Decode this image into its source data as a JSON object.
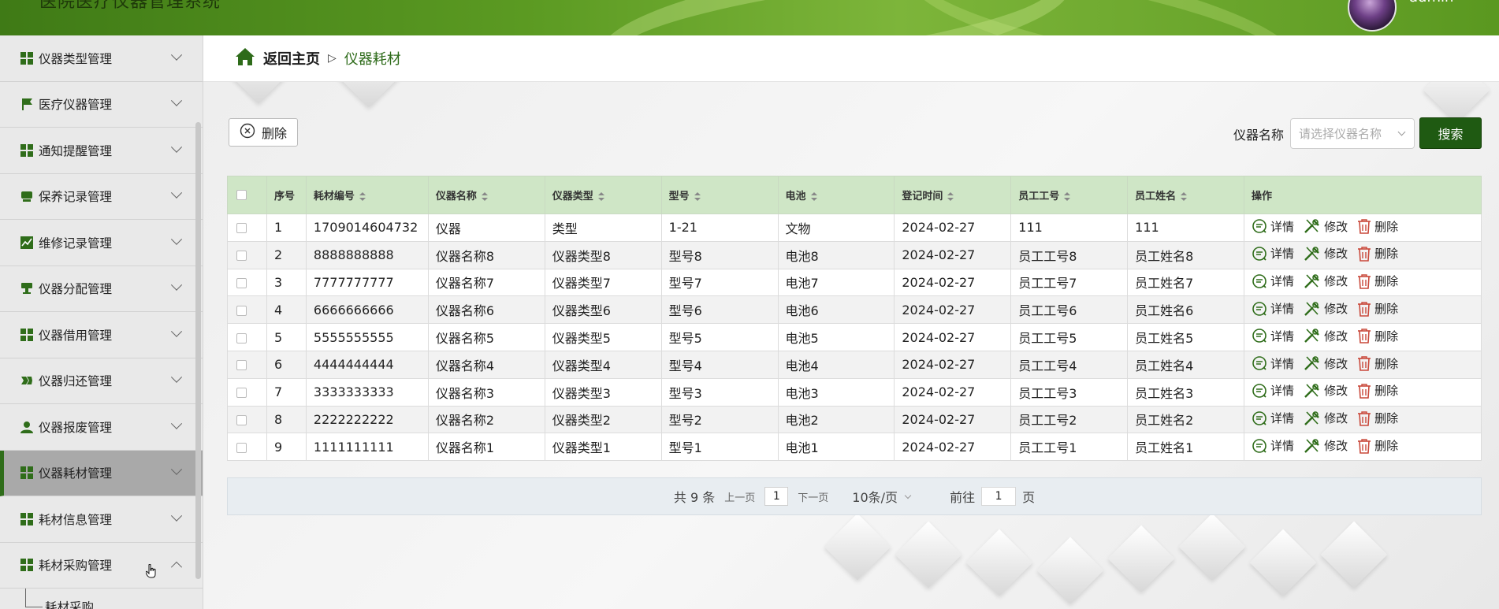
{
  "header": {
    "title": "医院医疗仪器管理系统",
    "username": "admin"
  },
  "sidebar": {
    "items": [
      {
        "label": "仪器类型管理",
        "icon": "grid-icon",
        "expanded": false
      },
      {
        "label": "医疗仪器管理",
        "icon": "flag-icon",
        "expanded": false
      },
      {
        "label": "通知提醒管理",
        "icon": "grid-icon",
        "expanded": false
      },
      {
        "label": "保养记录管理",
        "icon": "device-icon",
        "expanded": false
      },
      {
        "label": "维修记录管理",
        "icon": "chart-icon",
        "expanded": false
      },
      {
        "label": "仪器分配管理",
        "icon": "stamp-icon",
        "expanded": false
      },
      {
        "label": "仪器借用管理",
        "icon": "grid-icon",
        "expanded": false
      },
      {
        "label": "仪器归还管理",
        "icon": "link-icon",
        "expanded": false
      },
      {
        "label": "仪器报废管理",
        "icon": "user-icon",
        "expanded": false
      },
      {
        "label": "仪器耗材管理",
        "icon": "grid-icon",
        "expanded": false,
        "active": true
      },
      {
        "label": "耗材信息管理",
        "icon": "grid-icon",
        "expanded": false
      },
      {
        "label": "耗材采购管理",
        "icon": "grid-icon",
        "expanded": true
      }
    ],
    "subitem": "耗材采购"
  },
  "breadcrumb": {
    "home": "返回主页",
    "separator": "▷",
    "current": "仪器耗材"
  },
  "toolbar": {
    "delete_label": "删除",
    "search_label": "仪器名称",
    "search_placeholder": "请选择仪器名称",
    "search_button": "搜索"
  },
  "table": {
    "columns": [
      "",
      "序号",
      "耗材编号",
      "仪器名称",
      "仪器类型",
      "型号",
      "电池",
      "登记时间",
      "员工工号",
      "员工姓名",
      "操作"
    ],
    "rows": [
      [
        "1",
        "1709014604732",
        "仪器",
        "类型",
        "1-21",
        "文物",
        "2024-02-27",
        "111",
        "111"
      ],
      [
        "2",
        "8888888888",
        "仪器名称8",
        "仪器类型8",
        "型号8",
        "电池8",
        "2024-02-27",
        "员工工号8",
        "员工姓名8"
      ],
      [
        "3",
        "7777777777",
        "仪器名称7",
        "仪器类型7",
        "型号7",
        "电池7",
        "2024-02-27",
        "员工工号7",
        "员工姓名7"
      ],
      [
        "4",
        "6666666666",
        "仪器名称6",
        "仪器类型6",
        "型号6",
        "电池6",
        "2024-02-27",
        "员工工号6",
        "员工姓名6"
      ],
      [
        "5",
        "5555555555",
        "仪器名称5",
        "仪器类型5",
        "型号5",
        "电池5",
        "2024-02-27",
        "员工工号5",
        "员工姓名5"
      ],
      [
        "6",
        "4444444444",
        "仪器名称4",
        "仪器类型4",
        "型号4",
        "电池4",
        "2024-02-27",
        "员工工号4",
        "员工姓名4"
      ],
      [
        "7",
        "3333333333",
        "仪器名称3",
        "仪器类型3",
        "型号3",
        "电池3",
        "2024-02-27",
        "员工工号3",
        "员工姓名3"
      ],
      [
        "8",
        "2222222222",
        "仪器名称2",
        "仪器类型2",
        "型号2",
        "电池2",
        "2024-02-27",
        "员工工号2",
        "员工姓名2"
      ],
      [
        "9",
        "1111111111",
        "仪器名称1",
        "仪器类型1",
        "型号1",
        "电池1",
        "2024-02-27",
        "员工工号1",
        "员工姓名1"
      ]
    ],
    "actions": {
      "detail": "详情",
      "edit": "修改",
      "delete": "删除"
    }
  },
  "pagination": {
    "total": "共 9 条",
    "prev": "上一页",
    "current_page": "1",
    "next": "下一页",
    "page_size": "10条/页",
    "goto_prefix": "前往",
    "goto_value": "1",
    "goto_suffix": "页"
  },
  "colors": {
    "brand": "#1f5a12",
    "header_green": "#5b9a22",
    "table_header_bg": "#cfe6c6",
    "sidebar_active": "#a9a9a9"
  }
}
